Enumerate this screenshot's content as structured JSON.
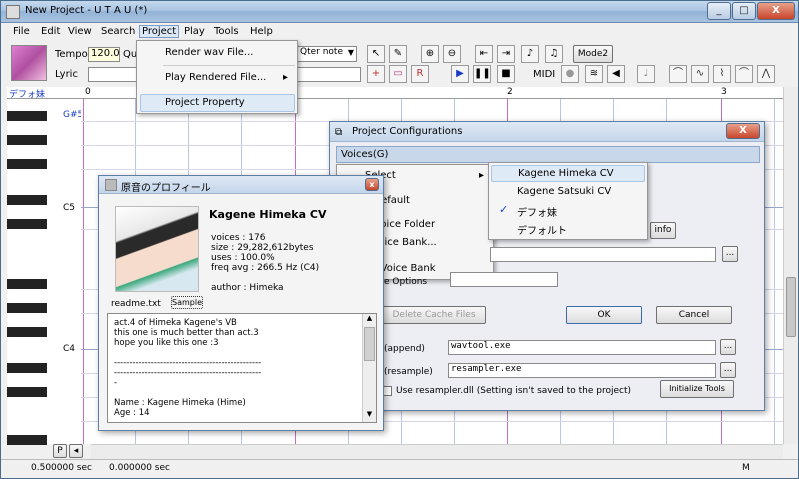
{
  "window": {
    "title": "New Project - U T A U (*)",
    "minimize": "_",
    "maximize": "□",
    "close": "X"
  },
  "menubar": [
    "File",
    "Edit",
    "View",
    "Search",
    "Project",
    "Play",
    "Tools",
    "Help"
  ],
  "toolbar": {
    "tempo_label": "Tempo",
    "tempo_value": "120.0",
    "quant_label": "Qu",
    "lyric_label": "Lyric",
    "note_select": "Qter note",
    "midi_label": "MIDI",
    "mode2": "Mode2"
  },
  "project_menu": {
    "items": [
      "Render wav File...",
      "Play Rendered File...",
      "Project Property"
    ]
  },
  "track": {
    "voice_label": "デフォ妹",
    "ruler": [
      "0",
      "2",
      "3"
    ],
    "keys": [
      "G#5",
      "C5",
      "C4"
    ]
  },
  "config_dialog": {
    "title": "Project Configurations",
    "tab": "Voices(G)",
    "select_label": "Select",
    "menu_items": [
      "s Default",
      "n voice Folder",
      "r Voice Bank...",
      "ad Voice Bank"
    ],
    "info_btn": "info",
    "options_label": "e Options",
    "delete_cache": "Delete Cache Files",
    "ok": "OK",
    "cancel": "Cancel",
    "append_label": "(append)",
    "append_value": "wavtool.exe",
    "resample_label": "(resample)",
    "resample_value": "resampler.exe",
    "use_resampler": "Use resampler.dll (Setting isn't saved to the project)",
    "init_tools": "Initialize Tools",
    "browse": "..."
  },
  "voice_submenu": {
    "items": [
      "Kagene Himeka CV",
      "Kagene Satsuki CV",
      "デフォ妹",
      "デフォルト"
    ],
    "checked": "✓"
  },
  "profile_dialog": {
    "title": "原音のプロフィール",
    "name": "Kagene Himeka CV",
    "stats": [
      "voices : 176",
      "size : 29,282,612bytes",
      "uses : 100.0%",
      "freq avg : 266.5 Hz (C4)"
    ],
    "author": "author : Himeka",
    "readme": "readme.txt",
    "sample_btn": "Sample",
    "text": [
      "act.4 of Himeka Kagene's VB",
      "this one is much better than act.3",
      "hope you like this one :3",
      "",
      "------------------------------------------------",
      "------------------------------------------------",
      "-",
      "",
      "Name : Kagene Himeka (Hime)",
      "Age : 14"
    ]
  },
  "status": {
    "left": "0.500000 sec",
    "mid": "0.000000 sec",
    "right": "M",
    "p": "P"
  }
}
